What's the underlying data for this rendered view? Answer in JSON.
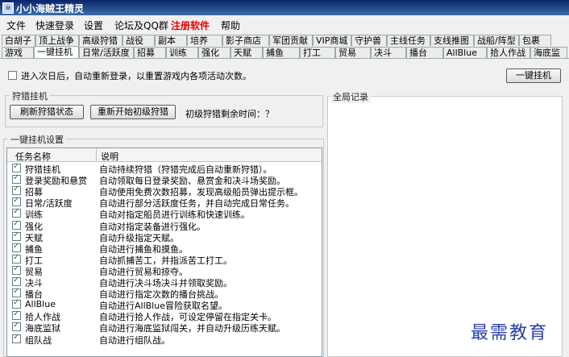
{
  "window": {
    "title": "小小海贼王精灵",
    "icon": "app-icon"
  },
  "menu": {
    "items": [
      "文件",
      "快速登录",
      "设置",
      "论坛及QQ群",
      "注册软件",
      "帮助"
    ],
    "highlight_index": 4,
    "highlight_color": "#e00000"
  },
  "tabs_row1": [
    "白胡子",
    "顶上战争",
    "高级狩猎",
    "战役",
    "副本",
    "培养",
    "影子商店",
    "军团贡献",
    "VIP商城",
    "守护兽",
    "主线任务",
    "支线推图",
    "战船/阵型",
    "包裹"
  ],
  "tabs_row2": [
    "游戏",
    "一键挂机",
    "日常/活跃度",
    "招募",
    "训练",
    "强化",
    "天赋",
    "捕鱼",
    "打工",
    "贸易",
    "决斗",
    "播台",
    "AllBlue",
    "拾人作战",
    "海底监"
  ],
  "active_tab": "一键挂机",
  "top_option": {
    "label": "进入次日后，自动重新登录，以重置游戏内各项活动次数。",
    "checked": false
  },
  "onekey_button": "一键挂机",
  "hunt": {
    "group_label": "狩猎挂机",
    "refresh_button": "刷新狩猎状态",
    "restart_button": "重新开始初级狩猎",
    "remaining_label": "初级狩猎剩余时间：？"
  },
  "settings": {
    "group_label": "一键挂机设置",
    "columns": [
      "任务名称",
      "说明"
    ],
    "rows": [
      {
        "name": "狩猎挂机",
        "desc": "自动持续狩猎（狩猎完成后自动重新狩猎）。",
        "checked": true
      },
      {
        "name": "登录奖励和悬赏",
        "desc": "自动领取每日登录奖励、悬赏金和决斗场奖励。",
        "checked": true
      },
      {
        "name": "招募",
        "desc": "自动使用免费次数招募，发现高级船员弹出提示框。",
        "checked": true
      },
      {
        "name": "日常/活跃度",
        "desc": "自动进行部分活跃度任务，并自动完成日常任务。",
        "checked": true
      },
      {
        "name": "训练",
        "desc": "自动对指定船员进行训练和快速训练。",
        "checked": true
      },
      {
        "name": "强化",
        "desc": "自动对指定装备进行强化。",
        "checked": true
      },
      {
        "name": "天赋",
        "desc": "自动升级指定天赋。",
        "checked": true
      },
      {
        "name": "捕鱼",
        "desc": "自动进行捕鱼和摸鱼。",
        "checked": true
      },
      {
        "name": "打工",
        "desc": "自动抓捕苦工，并指派苦工打工。",
        "checked": true
      },
      {
        "name": "贸易",
        "desc": "自动进行贸易和掠夺。",
        "checked": true
      },
      {
        "name": "决斗",
        "desc": "自动进行决斗场决斗并领取奖励。",
        "checked": true
      },
      {
        "name": "播台",
        "desc": "自动进行指定次数的播台挑战。",
        "checked": true
      },
      {
        "name": "AllBlue",
        "desc": "自动进行AllBlue冒险获取名望。",
        "checked": true
      },
      {
        "name": "拾人作战",
        "desc": "自动进行拾人作战，可设定停留在指定关卡。",
        "checked": true
      },
      {
        "name": "海底监狱",
        "desc": "自动进行海底监狱闯关，并自动升级历练天赋。",
        "checked": true
      },
      {
        "name": "组队战",
        "desc": "自动进行组队战。",
        "checked": true
      }
    ]
  },
  "log": {
    "group_label": "全局记录"
  },
  "watermark": "最需教育"
}
